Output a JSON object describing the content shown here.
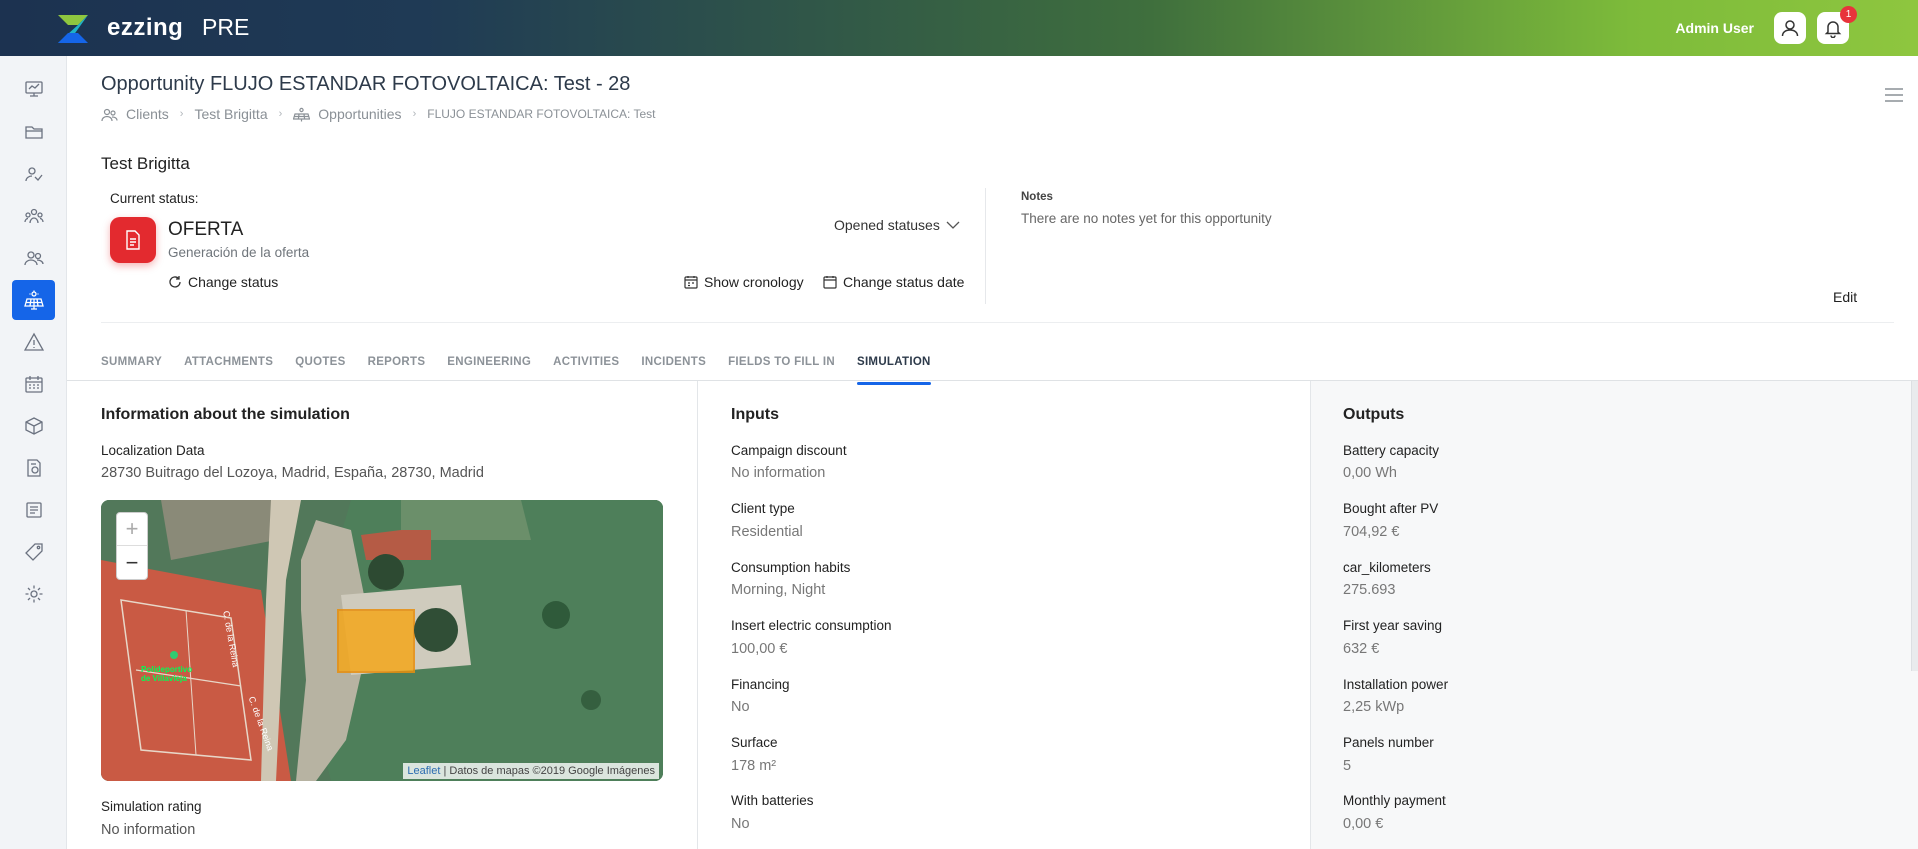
{
  "topbar": {
    "brand": "ezzing",
    "environment": "PRE",
    "user_name": "Admin User",
    "notifications_count": "1"
  },
  "sidebar": {
    "items": [
      {
        "icon": "dashboard-icon"
      },
      {
        "icon": "folder-icon"
      },
      {
        "icon": "contacts-icon"
      },
      {
        "icon": "team-icon"
      },
      {
        "icon": "clients-icon"
      },
      {
        "icon": "solar-panel-icon",
        "active": true
      },
      {
        "icon": "warning-icon"
      },
      {
        "icon": "calendar-icon"
      },
      {
        "icon": "box-icon"
      },
      {
        "icon": "invoice-icon"
      },
      {
        "icon": "report-icon"
      },
      {
        "icon": "tag-icon"
      },
      {
        "icon": "gear-icon"
      }
    ]
  },
  "header": {
    "title": "Opportunity FLUJO ESTANDAR FOTOVOLTAICA: Test - 28",
    "breadcrumb": {
      "clients": "Clients",
      "client": "Test Brigitta",
      "opportunities": "Opportunities",
      "current": "FLUJO ESTANDAR FOTOVOLTAICA: Test"
    }
  },
  "client_name": "Test Brigitta",
  "status": {
    "label": "Current status:",
    "name": "OFERTA",
    "description": "Generación de la oferta",
    "change_status": "Change status",
    "opened_statuses": "Opened statuses",
    "show_cronology": "Show cronology",
    "change_status_date": "Change status date",
    "color": "#e32a2f"
  },
  "notes": {
    "label": "Notes",
    "text": "There are no notes yet for this opportunity",
    "edit": "Edit"
  },
  "tabs": [
    {
      "label": "SUMMARY"
    },
    {
      "label": "ATTACHMENTS"
    },
    {
      "label": "QUOTES"
    },
    {
      "label": "REPORTS"
    },
    {
      "label": "ENGINEERING"
    },
    {
      "label": "ACTIVITIES"
    },
    {
      "label": "INCIDENTS"
    },
    {
      "label": "FIELDS TO FILL IN"
    },
    {
      "label": "SIMULATION",
      "active": true
    }
  ],
  "simulation_info": {
    "title": "Information about the simulation",
    "localization_label": "Localization Data",
    "localization_value": "28730 Buitrago del Lozoya, Madrid, España, 28730, Madrid",
    "map": {
      "zoom_in": "+",
      "zoom_out": "−",
      "attribution_leaflet": "Leaflet",
      "attribution_rest": " | Datos de mapas ©2019 Google Imágenes",
      "street_1": "C. de la Reina",
      "street_2": "C. de la Reina",
      "poi": "Polideportivo de Villavieja"
    },
    "rating_label": "Simulation rating",
    "rating_value": "No information"
  },
  "inputs": {
    "title": "Inputs",
    "fields": [
      {
        "label": "Campaign discount",
        "value": "No information"
      },
      {
        "label": "Client type",
        "value": "Residential"
      },
      {
        "label": "Consumption habits",
        "value": "Morning, Night"
      },
      {
        "label": "Insert electric consumption",
        "value": "100,00 €"
      },
      {
        "label": "Financing",
        "value": "No"
      },
      {
        "label": "Surface",
        "value": "178 m²"
      },
      {
        "label": "With batteries",
        "value": "No"
      }
    ]
  },
  "outputs": {
    "title": "Outputs",
    "fields": [
      {
        "label": "Battery capacity",
        "value": "0,00 Wh"
      },
      {
        "label": "Bought after PV",
        "value": "704,92 €"
      },
      {
        "label": "car_kilometers",
        "value": "275.693"
      },
      {
        "label": "First year saving",
        "value": "632 €"
      },
      {
        "label": "Installation power",
        "value": "2,25 kWp"
      },
      {
        "label": "Panels number",
        "value": "5"
      },
      {
        "label": "Monthly payment",
        "value": "0,00 €"
      }
    ]
  }
}
